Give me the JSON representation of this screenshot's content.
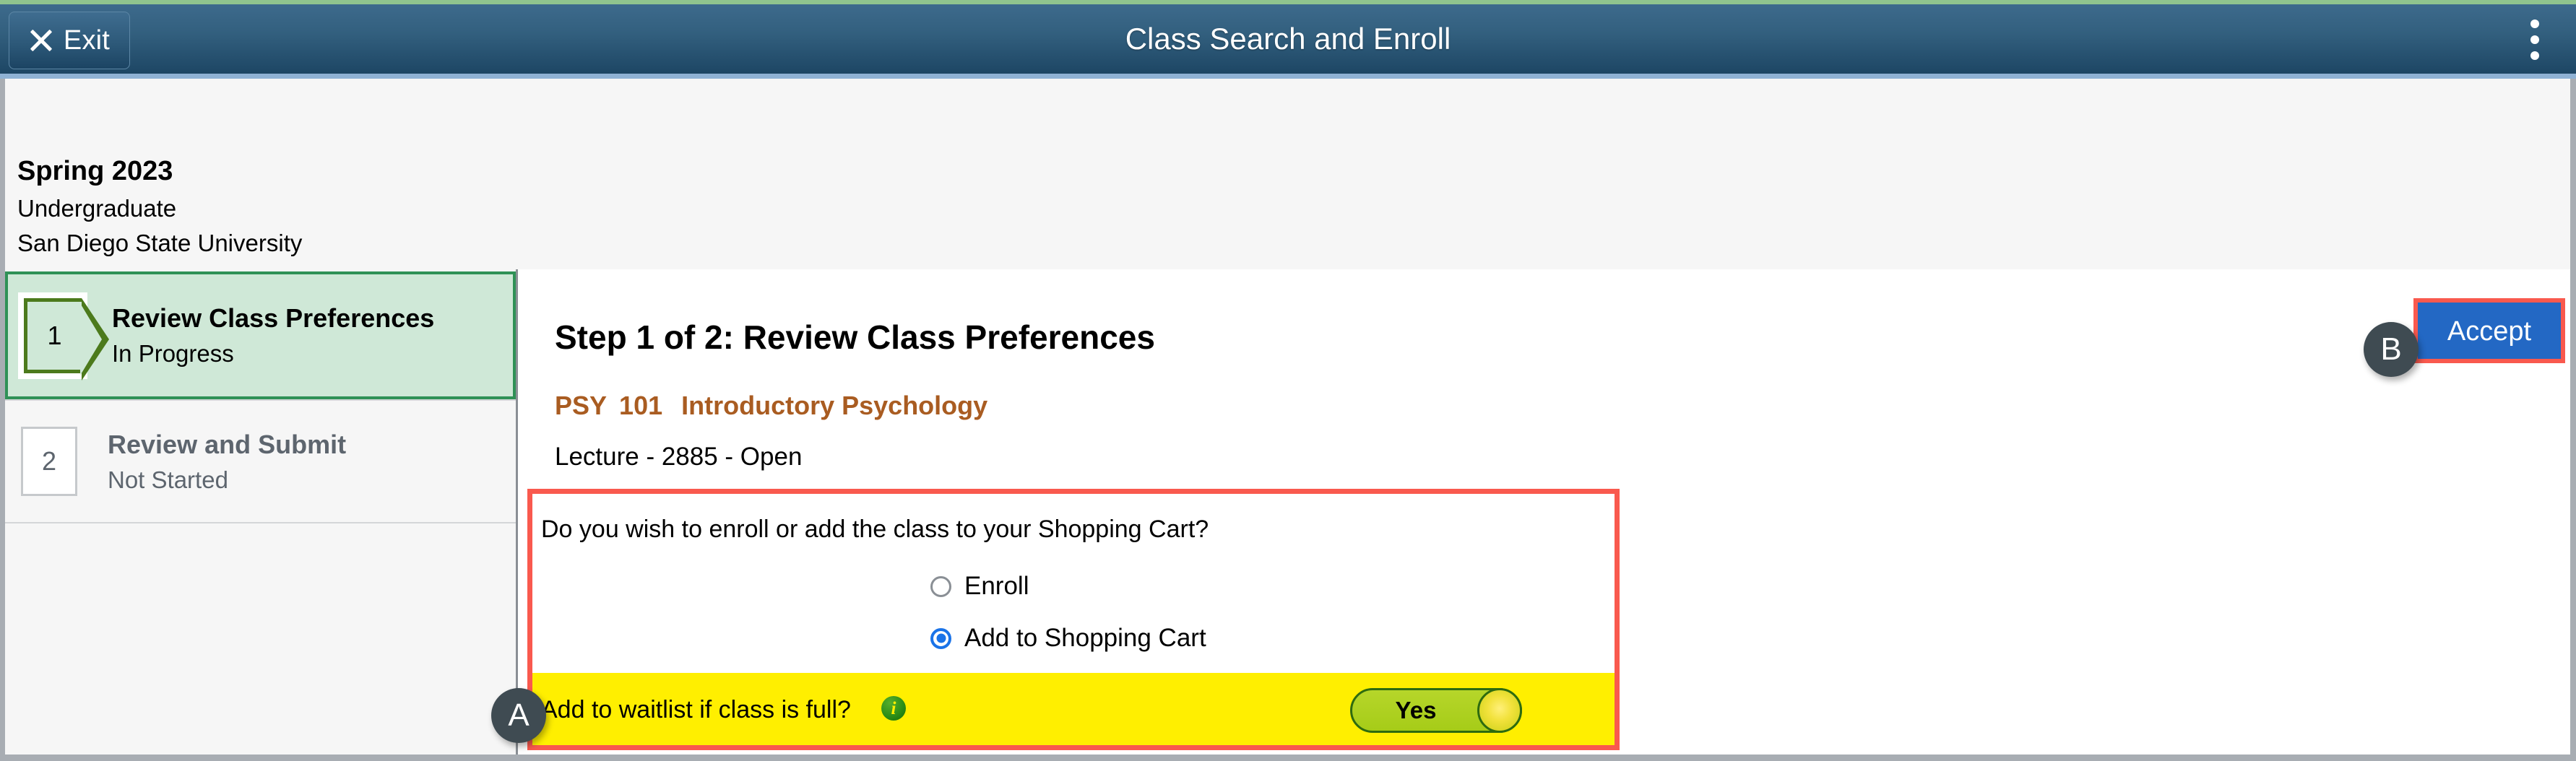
{
  "header": {
    "title": "Class Search and Enroll",
    "exit_label": "Exit",
    "exit_icon": "close-x-icon",
    "menu_icon": "kebab-menu-icon"
  },
  "term": {
    "name": "Spring 2023",
    "career": "Undergraduate",
    "institution": "San Diego State University"
  },
  "sidebar": {
    "steps": [
      {
        "number": "1",
        "title": "Review Class Preferences",
        "status": "In Progress"
      },
      {
        "number": "2",
        "title": "Review and Submit",
        "status": "Not Started"
      }
    ]
  },
  "main": {
    "title": "Step 1 of 2: Review Class Preferences",
    "course": {
      "subject": "PSY",
      "catalog_number": "101",
      "title": "Introductory Psychology"
    },
    "class_info": "Lecture - 2885 - Open",
    "accept_label": "Accept"
  },
  "options": {
    "question": "Do you wish to enroll or add the class to your Shopping Cart?",
    "choices": [
      {
        "label": "Enroll",
        "selected": false
      },
      {
        "label": "Add to Shopping Cart",
        "selected": true
      }
    ],
    "waitlist": {
      "label": "Add to waitlist if class is full?",
      "info_icon": "info-icon",
      "toggle_value": "Yes"
    }
  },
  "annotations": [
    {
      "letter": "A",
      "target": "waitlist-toggle-row"
    },
    {
      "letter": "B",
      "target": "accept-button"
    }
  ],
  "colors": {
    "header_blue": "#1d4664",
    "accent_green": "#90c48e",
    "step_active_bg": "#cfe8d7",
    "step_active_border": "#2f9156",
    "course_link": "#a95c21",
    "accept_blue": "#2368c4",
    "highlight_red": "#f9594e",
    "highlight_yellow": "#ffef00",
    "radio_blue": "#1a73e8",
    "toggle_green": "#a6cc18",
    "badge_grey": "#3f4b52"
  }
}
